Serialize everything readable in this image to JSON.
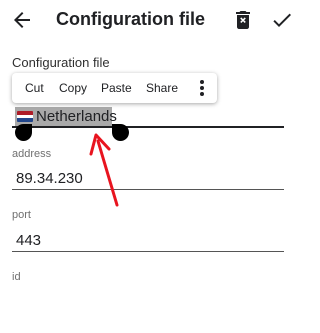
{
  "appbar": {
    "title": "Configuration file",
    "back_icon": "arrow-back-icon",
    "delete_icon": "delete-icon",
    "save_icon": "check-icon"
  },
  "context_menu": {
    "cut": "Cut",
    "copy": "Copy",
    "paste": "Paste",
    "share": "Share",
    "more_icon": "more-vertical-icon"
  },
  "fields": {
    "config": {
      "label": "Configuration file",
      "value": "Netherlands",
      "flag": "netherlands-flag-icon"
    },
    "address": {
      "label": "address",
      "value": "89.34.230"
    },
    "port": {
      "label": "port",
      "value": "443"
    },
    "id": {
      "label": "id"
    }
  },
  "colors": {
    "selection": "#a9a9a9",
    "annotation_arrow": "#e8141f",
    "flag": [
      "#ae1c28",
      "#ffffff",
      "#21468b"
    ]
  }
}
